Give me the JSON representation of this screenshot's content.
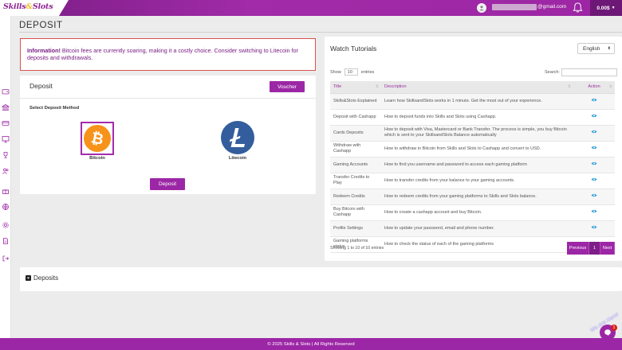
{
  "header": {
    "logo_part1": "Skills",
    "logo_amp": "&",
    "logo_part2": "Slots",
    "email_domain": "@gmail.com",
    "balance": "0.00$",
    "bell_icon": "bell-icon",
    "user_icon": "user-icon"
  },
  "sidebar": {
    "icons": [
      "wallet-icon",
      "bank-icon",
      "card-icon",
      "monitor-icon",
      "trophy-icon",
      "users-icon",
      "gift-icon",
      "globe-icon",
      "settings-icon",
      "document-icon",
      "logout-icon"
    ]
  },
  "page": {
    "title": "DEPOSIT"
  },
  "info": {
    "label": "Information!",
    "message": " Bitcoin fees are currently soaring, making it a costly choice. Consider switching to Litecoin for deposits and withdrawals."
  },
  "deposit": {
    "heading": "Deposit",
    "voucher_label": "Voucher",
    "method_label": "Select Deposit Method",
    "methods": [
      {
        "name": "Bitcoin",
        "icon": "bitcoin-icon",
        "selected": true,
        "color": "#f7931a"
      },
      {
        "name": "Litecoin",
        "icon": "litecoin-icon",
        "selected": false,
        "color": "#345d9d"
      }
    ],
    "submit_label": "Deposit"
  },
  "tutorials": {
    "title": "Watch Tutorials",
    "language": "English",
    "show_label": "Show",
    "show_value": "10",
    "entries_label": "entries",
    "search_label": "Search:",
    "columns": [
      "Title",
      "Description",
      "Action"
    ],
    "rows": [
      {
        "title": "Skills&Slots Explained",
        "description": "Learn how SkillsandSlots works in 1 minute. Get the most out of your experience."
      },
      {
        "title": "Deposit with Cashapp",
        "description": "How to deposit funds into Skills and Slots using Cashapp."
      },
      {
        "title": "Cards Deposits",
        "description": "How to deposit with Visa, Mastercard or Bank Transfer. The process is simple, you buy Bitcoin which is sent to your SkillsandSlots Balance automatically"
      },
      {
        "title": "Withdraw with Cashapp",
        "description": "How to withdraw in Bitcoin from Skills and Slots to Cashapp and convert to USD."
      },
      {
        "title": "Gaming Accounts",
        "description": "How to find you username and password to access each gaming platform"
      },
      {
        "title": "Transfer Credits to Play",
        "description": "How to transfer credits from your balance to your gaming accounts."
      },
      {
        "title": "Redeem Credits",
        "description": "How to redeem credits from your gaming platforms to Skills and Slots balance."
      },
      {
        "title": "Buy Bitcoin with Cashapp",
        "description": "How to create a cashapp account and buy Bitcoin."
      },
      {
        "title": "Profile Settings",
        "description": "How to update your password, email and phone number."
      },
      {
        "title": "Gaming platforms status",
        "description": "How to check the status of each of the gaming platforms"
      }
    ],
    "showing_text": "Showing 1 to 10 of 10 entries",
    "pager": {
      "previous": "Previous",
      "page": "1",
      "next": "Next"
    }
  },
  "deposits_section": {
    "label": "Deposits"
  },
  "footer": {
    "text": "© 2025 Skills & Slots | All Rights Reserved"
  },
  "chat": {
    "text": "We Are Here!",
    "badge": "1"
  },
  "colors": {
    "brand": "#9c27a6",
    "info_border": "#d9534f",
    "eye": "#2a9fd6"
  }
}
